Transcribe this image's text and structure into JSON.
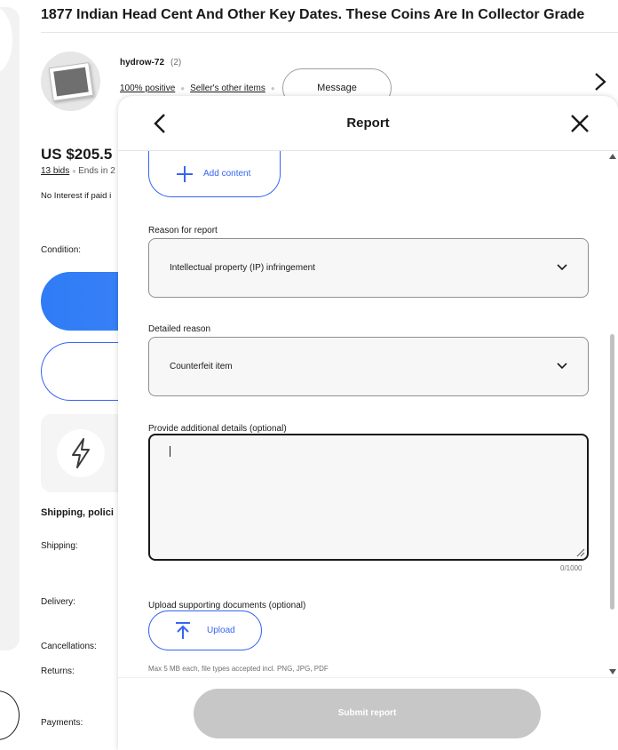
{
  "listing": {
    "title": "1877 Indian Head Cent And Other Key Dates. These Coins Are In Collector Grade",
    "seller": {
      "name": "hydrow-72",
      "feedback_count": "(2)",
      "positive": "100% positive",
      "other_items": "Seller's other items",
      "message_label": "Message"
    },
    "price": "US $205.5",
    "bids": "13 bids",
    "ends": "Ends in 2",
    "no_interest": "No Interest if paid i",
    "condition_label": "Condition:",
    "shipping_heading": "Shipping, polici",
    "shipping_label": "Shipping:",
    "delivery_label": "Delivery:",
    "cancellations_label": "Cancellations:",
    "returns_label": "Returns:",
    "payments_label": "Payments:"
  },
  "modal": {
    "title": "Report",
    "add_content_label": "Add content",
    "reason_label": "Reason for report",
    "reason_value": "Intellectual property (IP) infringement",
    "detailed_label": "Detailed reason",
    "detailed_value": "Counterfeit item",
    "details_label": "Provide additional details (optional)",
    "details_value": "",
    "counter": "0/1000",
    "upload_section_label": "Upload supporting documents (optional)",
    "upload_label": "Upload",
    "upload_hint": "Max 5 MB each, file types accepted incl. PNG, JPG, PDF",
    "submit_label": "Submit report"
  },
  "colors": {
    "accent": "#3665f3",
    "bid_button": "#3b82f6",
    "submit_disabled": "#c7c7c7"
  }
}
